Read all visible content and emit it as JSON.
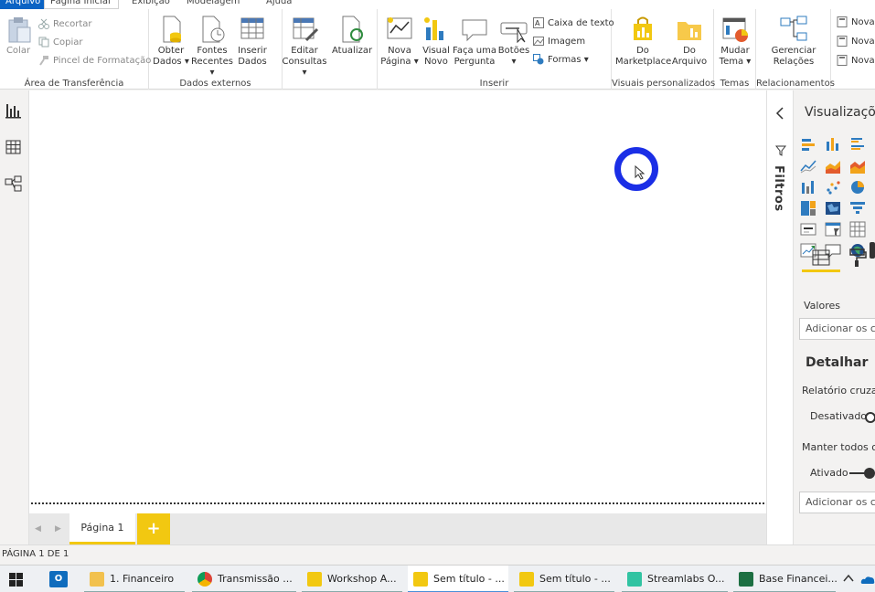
{
  "tabs": [
    "Arquivo",
    "Página Inicial",
    "Exibição",
    "Modelagem",
    "Ajuda"
  ],
  "ribbon": {
    "clipboard": {
      "label": "Área de Transferência",
      "paste": "Colar",
      "cut": "Recortar",
      "copy": "Copiar",
      "format_painter": "Pincel de Formatação"
    },
    "external_data": {
      "label": "Dados externos",
      "get_data": [
        "Obter",
        "Dados ▾"
      ],
      "recent_sources": [
        "Fontes",
        "Recentes ▾"
      ],
      "enter_data": [
        "Inserir",
        "Dados"
      ]
    },
    "queries": {
      "edit_queries": [
        "Editar",
        "Consultas ▾"
      ],
      "refresh": "Atualizar"
    },
    "insert": {
      "label": "Inserir",
      "new_page": [
        "Nova",
        "Página ▾"
      ],
      "new_visual": [
        "Visual",
        "Novo"
      ],
      "ask_question": [
        "Faça uma",
        "Pergunta"
      ],
      "buttons": [
        "Botões",
        "▾"
      ],
      "text_box": "Caixa de texto",
      "image": "Imagem",
      "shapes": "Formas ▾"
    },
    "custom_visuals": {
      "label": "Visuais personalizados",
      "marketplace": [
        "Do",
        "Marketplace"
      ],
      "from_file": [
        "Do",
        "Arquivo"
      ]
    },
    "themes": {
      "label": "Temas",
      "switch_theme": [
        "Mudar",
        "Tema ▾"
      ]
    },
    "relationships": {
      "label": "Relacionamentos",
      "manage": [
        "Gerenciar",
        "Relações"
      ]
    },
    "calculations": {
      "items": [
        "Nova",
        "Nova",
        "Nova"
      ]
    }
  },
  "filters": {
    "label": "Filtros"
  },
  "viz": {
    "title": "Visualizaçõ",
    "values_label": "Valores",
    "values_drop": "Adicionar os ca",
    "drillthrough": "Detalhar",
    "cross_report": "Relatório cruzad",
    "cross_report_state": "Desativado",
    "keep_filters": "Manter todos os",
    "keep_filters_state": "Ativado",
    "drill_drop": "Adicionar os ca"
  },
  "pages": {
    "tab": "Página 1",
    "add": "+"
  },
  "status": {
    "text": "PÁGINA 1 DE 1"
  },
  "taskbar": {
    "items": [
      "1. Financeiro",
      "Transmissão ...",
      "Workshop A...",
      "Sem título - ...",
      "Sem título - ...",
      "Streamlabs O...",
      "Base Financei..."
    ]
  },
  "colors": {
    "accent": "#f2c811",
    "file_tab": "#0b63c4",
    "cursor_ring": "#1a2ee6"
  }
}
